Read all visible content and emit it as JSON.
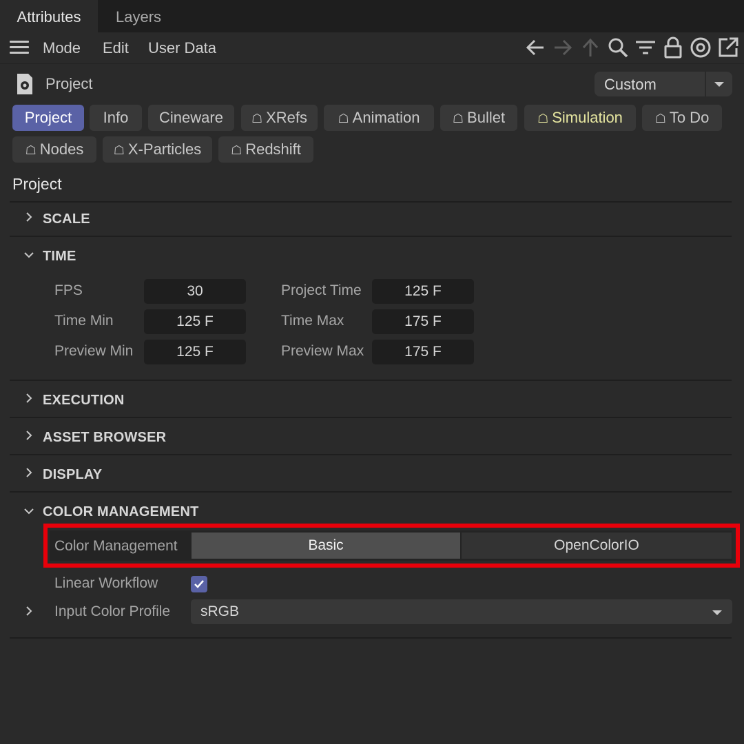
{
  "tabs": {
    "active": "Attributes",
    "inactive": "Layers"
  },
  "menu": {
    "mode": "Mode",
    "edit": "Edit",
    "user_data": "User Data"
  },
  "toolbar_icons": [
    "back-arrow-icon",
    "forward-arrow-icon",
    "up-arrow-icon",
    "search-icon",
    "filter-icon",
    "lock-icon",
    "target-icon",
    "open-external-icon"
  ],
  "object": {
    "title": "Project",
    "preset": "Custom"
  },
  "tab_buttons": {
    "project": "Project",
    "info": "Info",
    "cineware": "Cineware",
    "xrefs": "XRefs",
    "animation": "Animation",
    "bullet": "Bullet",
    "simulation": "Simulation",
    "todo": "To Do",
    "nodes": "Nodes",
    "xparticles": "X-Particles",
    "redshift": "Redshift"
  },
  "section_title": "Project",
  "groups": {
    "scale": "SCALE",
    "time": "TIME",
    "execution": "EXECUTION",
    "asset_browser": "ASSET BROWSER",
    "display": "DISPLAY",
    "color_management": "COLOR MANAGEMENT"
  },
  "time": {
    "fps_label": "FPS",
    "fps": "30",
    "project_time_label": "Project Time",
    "project_time": "125 F",
    "time_min_label": "Time Min",
    "time_min": "125 F",
    "time_max_label": "Time Max",
    "time_max": "175 F",
    "preview_min_label": "Preview Min",
    "preview_min": "125 F",
    "preview_max_label": "Preview Max",
    "preview_max": "175 F"
  },
  "color_mgmt": {
    "label": "Color Management",
    "option_basic": "Basic",
    "option_ocio": "OpenColorIO",
    "selected": "Basic",
    "linear_workflow_label": "Linear Workflow",
    "linear_workflow": true,
    "input_profile_label": "Input Color Profile",
    "input_profile": "sRGB"
  },
  "colors": {
    "accent": "#5a62a6",
    "highlight": "#e8000a",
    "simulation_text": "#e6e6a0"
  }
}
